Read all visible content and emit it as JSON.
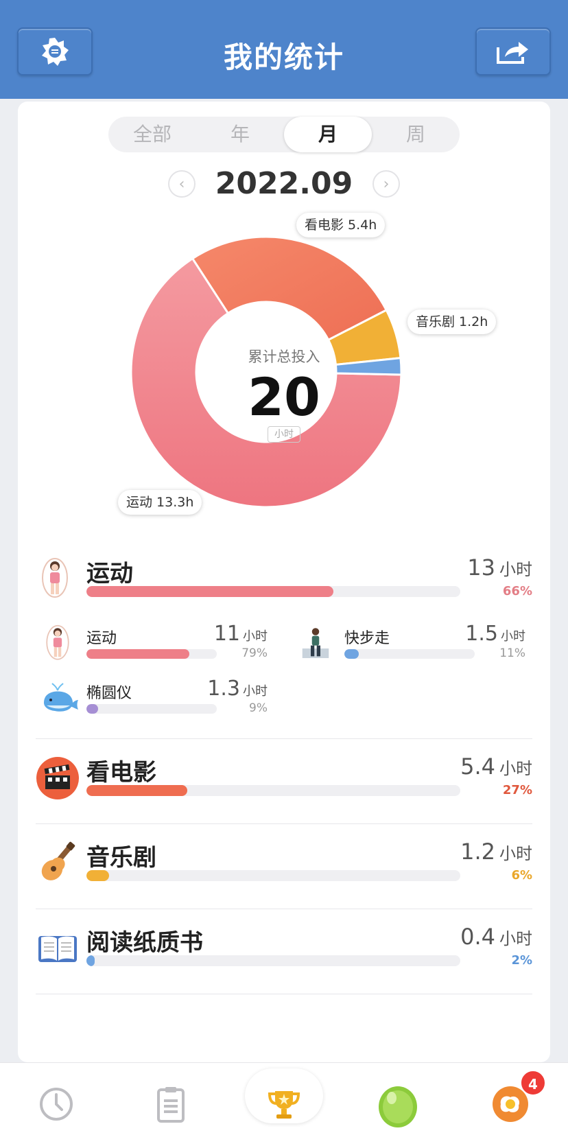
{
  "header": {
    "title": "我的统计",
    "settings_icon": "gear-badge-icon",
    "share_icon": "share-icon"
  },
  "tabs": {
    "items": [
      "全部",
      "年",
      "月",
      "周"
    ],
    "active": "月"
  },
  "date": {
    "value": "2022.09"
  },
  "colors": {
    "sport": "#f07e86",
    "movie": "#f0745a",
    "musical": "#f1b036",
    "reading": "#6fa4e1",
    "elliptical": "#a68fd4"
  },
  "chart_data": {
    "type": "pie",
    "center_label": "累计总投入",
    "center_value": "20",
    "center_unit": "小时",
    "slices": [
      {
        "name": "运动",
        "value": 13.3,
        "label": "运动 13.3h"
      },
      {
        "name": "看电影",
        "value": 5.4,
        "label": "看电影 5.4h"
      },
      {
        "name": "音乐剧",
        "value": 1.2,
        "label": "音乐剧 1.2h"
      },
      {
        "name": "阅读纸质书",
        "value": 0.4
      }
    ]
  },
  "categories": [
    {
      "name": "运动",
      "hours": "13",
      "unit": "小时",
      "pct": "66%",
      "fraction": 0.66,
      "icon": "jump-rope-girl-icon",
      "subs": [
        {
          "name": "运动",
          "hours": "11",
          "unit": "小时",
          "pct": "79%",
          "fraction": 0.79,
          "icon": "jump-rope-girl-icon"
        },
        {
          "name": "快步走",
          "hours": "1.5",
          "unit": "小时",
          "pct": "11%",
          "fraction": 0.11,
          "icon": "walking-man-icon"
        },
        {
          "name": "椭圆仪",
          "hours": "1.3",
          "unit": "小时",
          "pct": "9%",
          "fraction": 0.09,
          "icon": "whale-icon"
        }
      ]
    },
    {
      "name": "看电影",
      "hours": "5.4",
      "unit": "小时",
      "pct": "27%",
      "fraction": 0.27,
      "icon": "clapperboard-icon"
    },
    {
      "name": "音乐剧",
      "hours": "1.2",
      "unit": "小时",
      "pct": "6%",
      "fraction": 0.06,
      "icon": "ukulele-icon"
    },
    {
      "name": "阅读纸质书",
      "hours": "0.4",
      "unit": "小时",
      "pct": "2%",
      "fraction": 0.02,
      "icon": "open-book-icon"
    }
  ],
  "tabbar": {
    "items": [
      "clock-icon",
      "clipboard-icon",
      "trophy-icon",
      "green-egg-icon",
      "fried-egg-icon"
    ],
    "active": "trophy-icon",
    "badge": "4"
  }
}
